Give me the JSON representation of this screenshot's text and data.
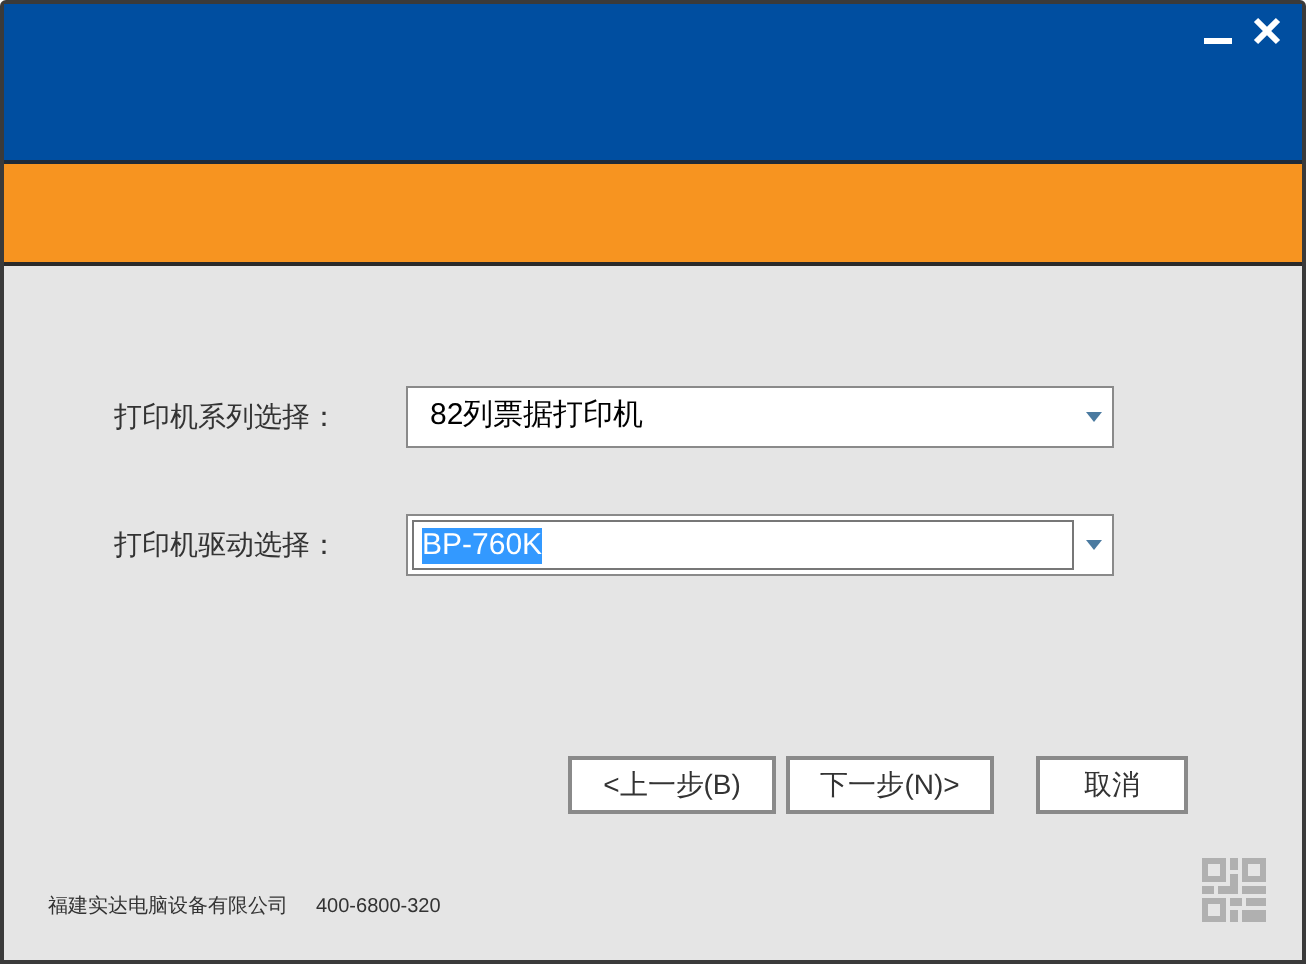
{
  "fields": [
    {
      "label": "打印机系列选择：",
      "value": "82列票据打印机",
      "focused": false
    },
    {
      "label": "打印机驱动选择：",
      "value": "BP-760K",
      "focused": true
    }
  ],
  "buttons": [
    {
      "label": "<上一步(B)"
    },
    {
      "label": "下一步(N)>"
    },
    {
      "label": "取消"
    }
  ],
  "footer": {
    "company": "福建实达电脑设备有限公司",
    "phone": "400-6800-320"
  }
}
